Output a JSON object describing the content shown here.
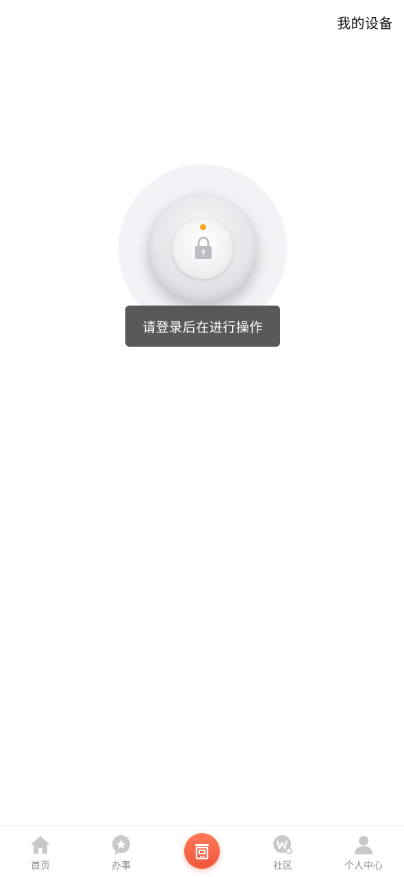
{
  "header": {
    "my_devices_label": "我的设备"
  },
  "lock": {
    "status_dot_color": "#f5a623",
    "icon": "padlock-icon"
  },
  "toast": {
    "message": "请登录后在进行操作"
  },
  "tabbar": {
    "accent_color": "#f2553a",
    "items": [
      {
        "label": "首页",
        "icon": "home-icon"
      },
      {
        "label": "办事",
        "icon": "star-bubble-icon"
      },
      {
        "label": "",
        "icon": "door-lock-icon"
      },
      {
        "label": "社区",
        "icon": "community-w-icon"
      },
      {
        "label": "个人中心",
        "icon": "person-icon"
      }
    ]
  }
}
